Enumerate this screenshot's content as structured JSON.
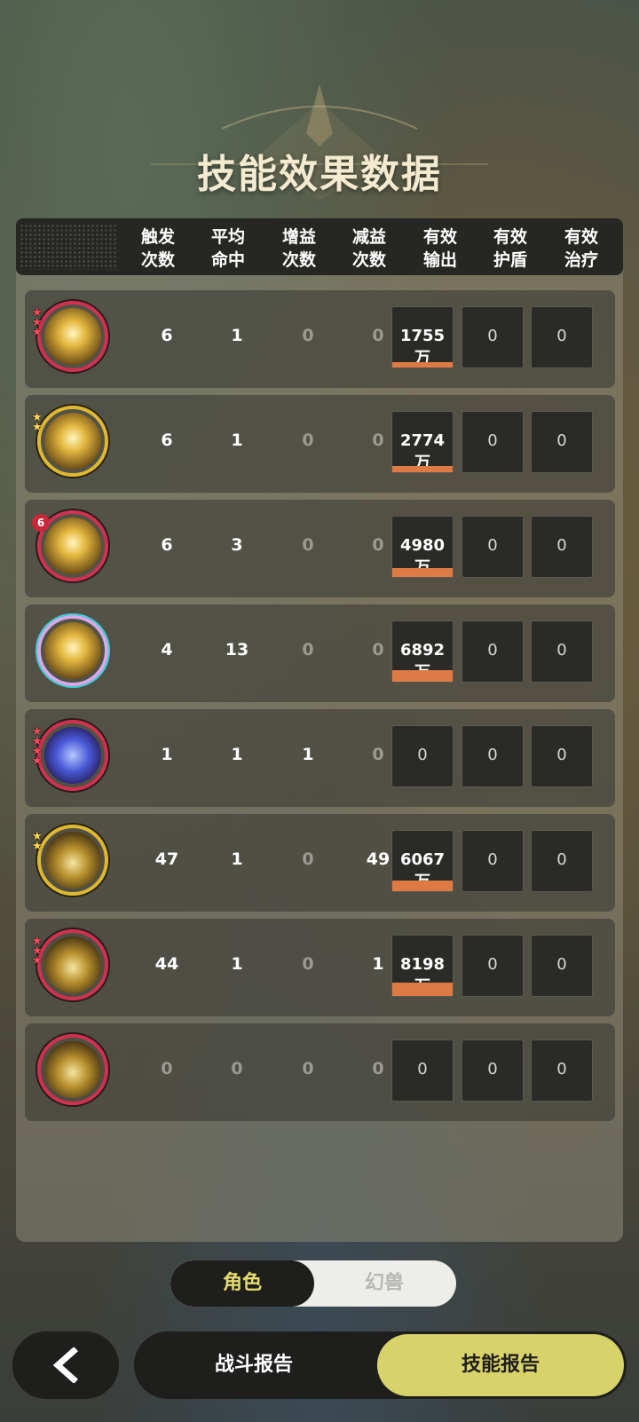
{
  "title": "技能效果数据",
  "headers": [
    [
      "触发",
      "次数"
    ],
    [
      "平均",
      "命中"
    ],
    [
      "增益",
      "次数"
    ],
    [
      "减益",
      "次数"
    ],
    [
      "有效",
      "输出"
    ],
    [
      "有效",
      "护盾"
    ],
    [
      "有效",
      "治疗"
    ]
  ],
  "rows": [
    {
      "icon": "skill-burst-icon",
      "ring": "red",
      "stars": "3 red",
      "trigger": "6",
      "hits": "1",
      "buff": "0",
      "debuff": "0",
      "damage": "1755万",
      "damage_share": 0.22,
      "shield": "0",
      "heal": "0"
    },
    {
      "icon": "skill-sparks-icon",
      "ring": "gold",
      "stars": "2 gold",
      "trigger": "6",
      "hits": "1",
      "buff": "0",
      "debuff": "0",
      "damage": "2774万",
      "damage_share": 0.34,
      "shield": "0",
      "heal": "0"
    },
    {
      "icon": "skill-lightning-icon",
      "ring": "red",
      "stars": "6",
      "badge": "6",
      "trigger": "6",
      "hits": "3",
      "buff": "0",
      "debuff": "0",
      "damage": "4980万",
      "damage_share": 0.61,
      "shield": "0",
      "heal": "0"
    },
    {
      "icon": "skill-thunder-orb-icon",
      "ring": "rainbow",
      "stars": "",
      "trigger": "4",
      "hits": "13",
      "buff": "0",
      "debuff": "0",
      "damage": "6892万",
      "damage_share": 0.84,
      "shield": "0",
      "heal": "0"
    },
    {
      "icon": "skill-arcane-sphere-icon",
      "ring": "red",
      "stars": "4 red",
      "trigger": "1",
      "hits": "1",
      "buff": "1",
      "debuff": "0",
      "damage": "0",
      "damage_share": 0,
      "shield": "0",
      "heal": "0"
    },
    {
      "icon": "skill-ring-icon",
      "ring": "gold",
      "stars": "2 gold",
      "trigger": "47",
      "hits": "1",
      "buff": "0",
      "debuff": "49",
      "damage": "6067万",
      "damage_share": 0.74,
      "shield": "0",
      "heal": "0"
    },
    {
      "icon": "skill-slash-icon",
      "ring": "red",
      "stars": "3 red",
      "trigger": "44",
      "hits": "1",
      "buff": "0",
      "debuff": "1",
      "damage": "8198万",
      "damage_share": 1.0,
      "shield": "0",
      "heal": "0"
    },
    {
      "icon": "skill-rise-icon",
      "ring": "red",
      "stars": "",
      "trigger": "0",
      "hits": "0",
      "buff": "0",
      "debuff": "0",
      "damage": "0",
      "damage_share": 0,
      "shield": "0",
      "heal": "0"
    }
  ],
  "toggle": {
    "character": "角色",
    "beast": "幻兽"
  },
  "tabs": {
    "battle_report": "战斗报告",
    "skill_report": "技能报告"
  },
  "colors": {
    "accent": "#d8d26a",
    "damage_bar": "#e07a45",
    "ring_red": "#d1314f",
    "ring_gold": "#e0b830"
  }
}
